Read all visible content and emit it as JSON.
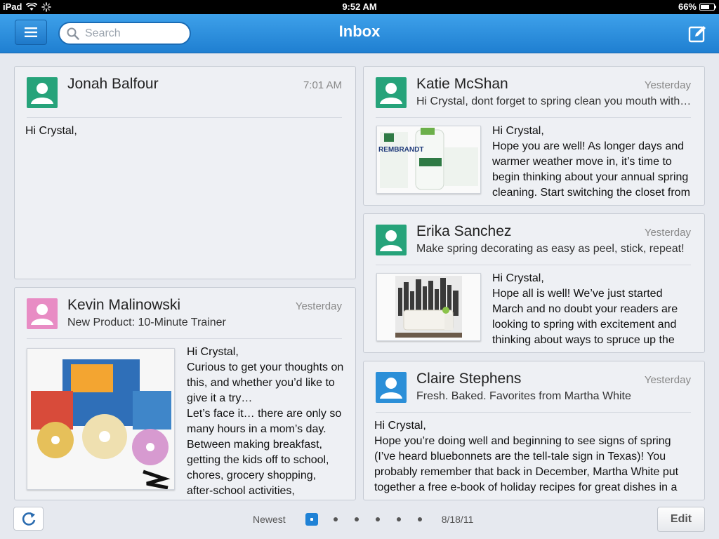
{
  "status": {
    "device": "iPad",
    "time": "9:52 AM",
    "battery": "66%",
    "battery_level": 0.66
  },
  "nav": {
    "title": "Inbox",
    "search_placeholder": "Search"
  },
  "messages": [
    {
      "sender": "Jonah Balfour",
      "time": "7:01 AM",
      "subject": "",
      "body": "Hi Crystal,",
      "avatar_color": "#26a37a"
    },
    {
      "sender": "Kevin Malinowski",
      "time": "Yesterday",
      "subject": "New Product: 10-Minute Trainer",
      "body": "Hi Crystal,\nCurious to get your thoughts on this, and whether you’d like to give it a try…\nLet’s face it… there are only so many hours in a mom’s day. Between making breakfast, getting the kids off to school, chores, grocery shopping, after-school activities,",
      "avatar_color": "#e88cc4"
    },
    {
      "sender": "Katie McShan",
      "time": "Yesterday",
      "subject": "Hi Crystal, dont forget to spring clean you mouth with REMBRANDT",
      "body": "Hi Crystal,\nHope you are well! As longer days and warmer weather move in, it’s time to begin thinking about your annual spring cleaning. Start switching the closet from",
      "avatar_color": "#26a37a",
      "thumb_brand": "REMBRANDT"
    },
    {
      "sender": "Erika Sanchez",
      "time": "Yesterday",
      "subject": "Make spring decorating as easy as peel, stick, repeat!",
      "body": "Hi Crystal,\nHope all is well! We’ve just started March and no doubt your readers are looking to spring with excitement and thinking about ways to spruce up the",
      "avatar_color": "#26a37a"
    },
    {
      "sender": "Claire Stephens",
      "time": "Yesterday",
      "subject": "Fresh. Baked. Favorites from Martha White",
      "body": "Hi Crystal,\nHope you’re doing well and beginning to see signs of spring (I’ve heard bluebonnets are the tell-tale sign in Texas)! You probably remember that back in December, Martha White put together a free e-book of holiday recipes for great dishes in a",
      "avatar_color": "#2b8fd8"
    }
  ],
  "footer": {
    "sort_label": "Newest",
    "date": "8/18/11",
    "edit_label": "Edit"
  },
  "icons": [
    "wifi-icon",
    "activity-spinner-icon",
    "menu-icon",
    "search-icon",
    "compose-icon",
    "person-icon",
    "refresh-icon"
  ]
}
